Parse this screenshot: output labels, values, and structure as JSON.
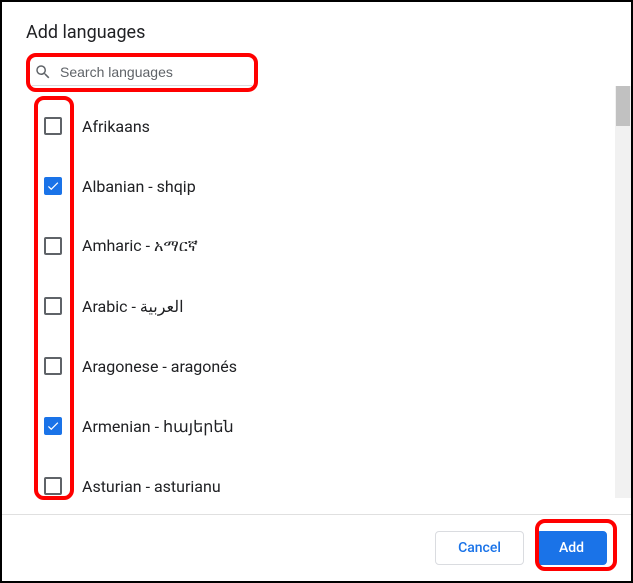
{
  "dialog": {
    "title": "Add languages"
  },
  "search": {
    "placeholder": "Search languages"
  },
  "languages": [
    {
      "label": "Afrikaans",
      "checked": false
    },
    {
      "label": "Albanian - shqip",
      "checked": true
    },
    {
      "label": "Amharic - አማርኛ",
      "checked": false
    },
    {
      "label": "Arabic - العربية",
      "checked": false
    },
    {
      "label": "Aragonese - aragonés",
      "checked": false
    },
    {
      "label": "Armenian - հայերեն",
      "checked": true
    },
    {
      "label": "Asturian - asturianu",
      "checked": false
    }
  ],
  "footer": {
    "cancel": "Cancel",
    "add": "Add"
  },
  "highlight_color": "#ff0000",
  "accent_color": "#1a73e8"
}
